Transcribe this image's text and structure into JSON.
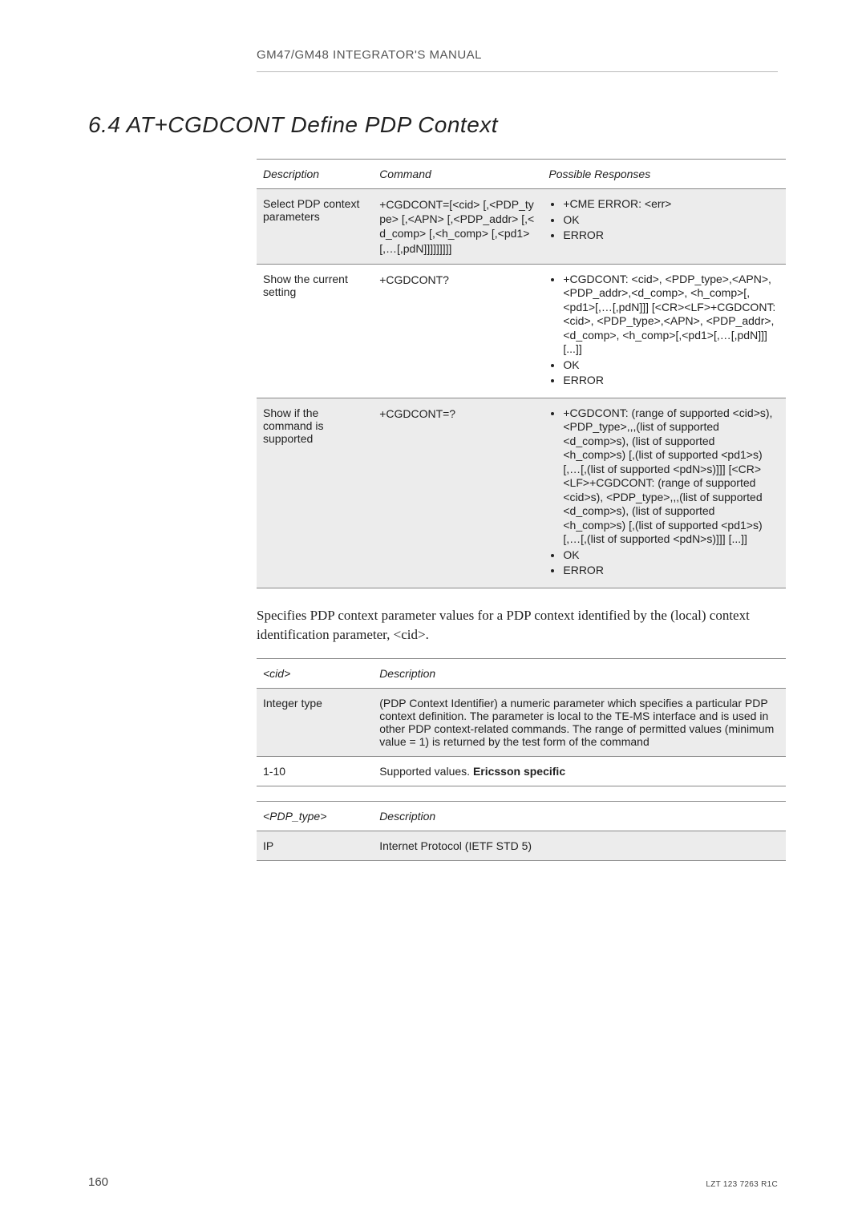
{
  "running_head": "GM47/GM48 INTEGRATOR'S MANUAL",
  "section_title": "6.4 AT+CGDCONT Define PDP Context",
  "main_table": {
    "headers": [
      "Description",
      "Command",
      "Possible Responses"
    ],
    "rows": [
      {
        "shaded": true,
        "description": "Select PDP context parameters",
        "command": "+CGDCONT=[<cid> [,<PDP_type> [,<APN> [,<PDP_addr> [,<d_comp> [,<h_comp> [,<pd1> [,…[,pdN]]]]]]]]]",
        "responses": [
          "+CME ERROR: <err>",
          "OK",
          "ERROR"
        ]
      },
      {
        "shaded": false,
        "description": "Show the current setting",
        "command": "+CGDCONT?",
        "responses": [
          "+CGDCONT: <cid>, <PDP_type>,<APN>, <PDP_addr>,<d_comp>, <h_comp>[,<pd1>[,…[,pdN]]] [<CR><LF>+CGDCONT: <cid>, <PDP_type>,<APN>, <PDP_addr>,<d_comp>, <h_comp>[,<pd1>[,…[,pdN]]] [...]]",
          "OK",
          "ERROR"
        ]
      },
      {
        "shaded": true,
        "description": "Show if the command is supported",
        "command": "+CGDCONT=?",
        "responses": [
          "+CGDCONT: (range of supported <cid>s), <PDP_type>,,,(list of supported <d_comp>s), (list of supported <h_comp>s) [,(list of supported <pd1>s) [,…[,(list of supported <pdN>s)]]] [<CR><LF>+CGDCONT: (range of supported <cid>s), <PDP_type>,,,(list of supported <d_comp>s), (list of supported <h_comp>s) [,(list of supported <pd1>s)[,…[,(list of supported <pdN>s)]]] [...]]",
          "OK",
          "ERROR"
        ]
      }
    ]
  },
  "body_text": "Specifies PDP context parameter values for a PDP context identified by the (local) context identification parameter, <cid>.",
  "param_tables": [
    {
      "header_key": "<cid>",
      "header_val": "Description",
      "rows": [
        {
          "shaded": true,
          "key": "Integer type",
          "val": "(PDP Context Identifier) a numeric parameter which specifies a particular PDP context definition. The parameter is local to the TE-MS interface and is used in other PDP context-related commands. The range of permitted values (minimum value = 1) is returned by the test form of the command"
        },
        {
          "shaded": false,
          "key": "1-10",
          "val_prefix": "Supported values. ",
          "val_bold": "Ericsson specific"
        }
      ]
    },
    {
      "header_key": "<PDP_type>",
      "header_val": "Description",
      "rows": [
        {
          "shaded": true,
          "key": "IP",
          "val": "Internet Protocol (IETF STD 5)"
        }
      ]
    }
  ],
  "page_number": "160",
  "footer_right": "LZT 123 7263 R1C"
}
